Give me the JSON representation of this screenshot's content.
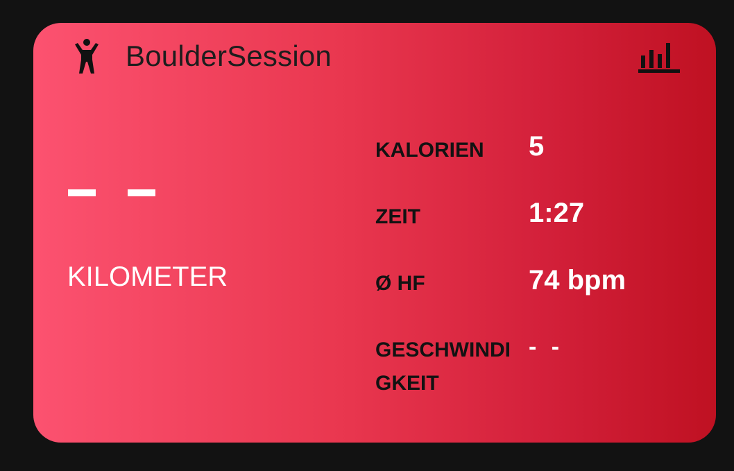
{
  "card": {
    "title": "BoulderSession",
    "activity_icon": "person-arms-raised-icon",
    "stats_icon": "bar-chart-icon",
    "primary": {
      "value": "– –",
      "unit": "KILOMETER"
    },
    "stats": {
      "calories": {
        "label": "KALORIEN",
        "value": "5"
      },
      "time": {
        "label": "ZEIT",
        "value": "1:27"
      },
      "heart_rate": {
        "label": "Ø HF",
        "value": "74 bpm"
      },
      "speed": {
        "label": "GESCHWINDIGKEIT",
        "value": "- -"
      }
    }
  },
  "colors": {
    "background": "#121212",
    "card_gradient_start": "#fc5270",
    "card_gradient_end": "#bf1122",
    "label_text": "#121212",
    "value_text": "#ffffff"
  }
}
